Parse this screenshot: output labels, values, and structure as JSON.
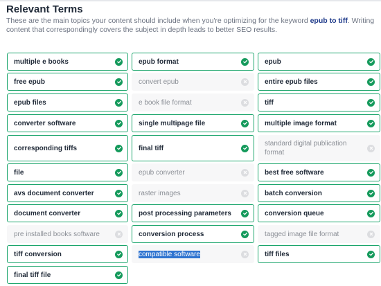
{
  "section": {
    "title": "Relevant Terms",
    "description_before": "These are the main topics your content should include when you're optimizing for the keyword ",
    "keyword": "epub to tiff",
    "description_after": ". Writing content that correspondingly covers the subject in depth leads to better SEO results."
  },
  "colors": {
    "accent": "#1aa56b",
    "check": "#159a5c",
    "inactive_bg": "#f7f7f8",
    "selection": "#2f74d0"
  },
  "terms": [
    {
      "label": "multiple e books",
      "used": true,
      "icon": "check-circle-icon"
    },
    {
      "label": "epub format",
      "used": true,
      "icon": "check-circle-icon"
    },
    {
      "label": "epub",
      "used": true,
      "icon": "check-circle-icon"
    },
    {
      "label": "free epub",
      "used": true,
      "icon": "check-circle-icon"
    },
    {
      "label": "convert epub",
      "used": false,
      "icon": "x-circle-icon"
    },
    {
      "label": "entire epub files",
      "used": true,
      "icon": "check-circle-icon"
    },
    {
      "label": "epub files",
      "used": true,
      "icon": "check-circle-icon"
    },
    {
      "label": "e book file format",
      "used": false,
      "icon": "x-circle-icon"
    },
    {
      "label": "tiff",
      "used": true,
      "icon": "check-circle-icon"
    },
    {
      "label": "converter software",
      "used": true,
      "icon": "check-circle-icon"
    },
    {
      "label": "single multipage file",
      "used": true,
      "icon": "check-circle-icon"
    },
    {
      "label": "multiple image format",
      "used": true,
      "icon": "check-circle-icon"
    },
    {
      "label": "corresponding tiffs",
      "used": true,
      "icon": "check-circle-icon"
    },
    {
      "label": "final tiff",
      "used": true,
      "icon": "check-circle-icon"
    },
    {
      "label": "standard digital publication format",
      "used": false,
      "icon": "x-circle-icon"
    },
    {
      "label": "file",
      "used": true,
      "icon": "check-circle-icon"
    },
    {
      "label": "epub converter",
      "used": false,
      "icon": "x-circle-icon"
    },
    {
      "label": "best free software",
      "used": true,
      "icon": "check-circle-icon"
    },
    {
      "label": "avs document converter",
      "used": true,
      "icon": "check-circle-icon"
    },
    {
      "label": "raster images",
      "used": false,
      "icon": "x-circle-icon"
    },
    {
      "label": "batch conversion",
      "used": true,
      "icon": "check-circle-icon"
    },
    {
      "label": "document converter",
      "used": true,
      "icon": "check-circle-icon"
    },
    {
      "label": "post processing parameters",
      "used": true,
      "icon": "check-circle-icon"
    },
    {
      "label": "conversion queue",
      "used": true,
      "icon": "check-circle-icon"
    },
    {
      "label": "pre installed books software",
      "used": false,
      "icon": "x-circle-icon"
    },
    {
      "label": "conversion process",
      "used": true,
      "icon": "check-circle-icon"
    },
    {
      "label": "tagged image file format",
      "used": false,
      "icon": "x-circle-icon"
    },
    {
      "label": "tiff conversion",
      "used": true,
      "icon": "check-circle-icon"
    },
    {
      "label": "compatible software",
      "used": false,
      "icon": "x-circle-icon",
      "selected": true
    },
    {
      "label": "tiff files",
      "used": true,
      "icon": "check-circle-icon"
    },
    {
      "label": "final tiff file",
      "used": true,
      "icon": "check-circle-icon"
    }
  ]
}
